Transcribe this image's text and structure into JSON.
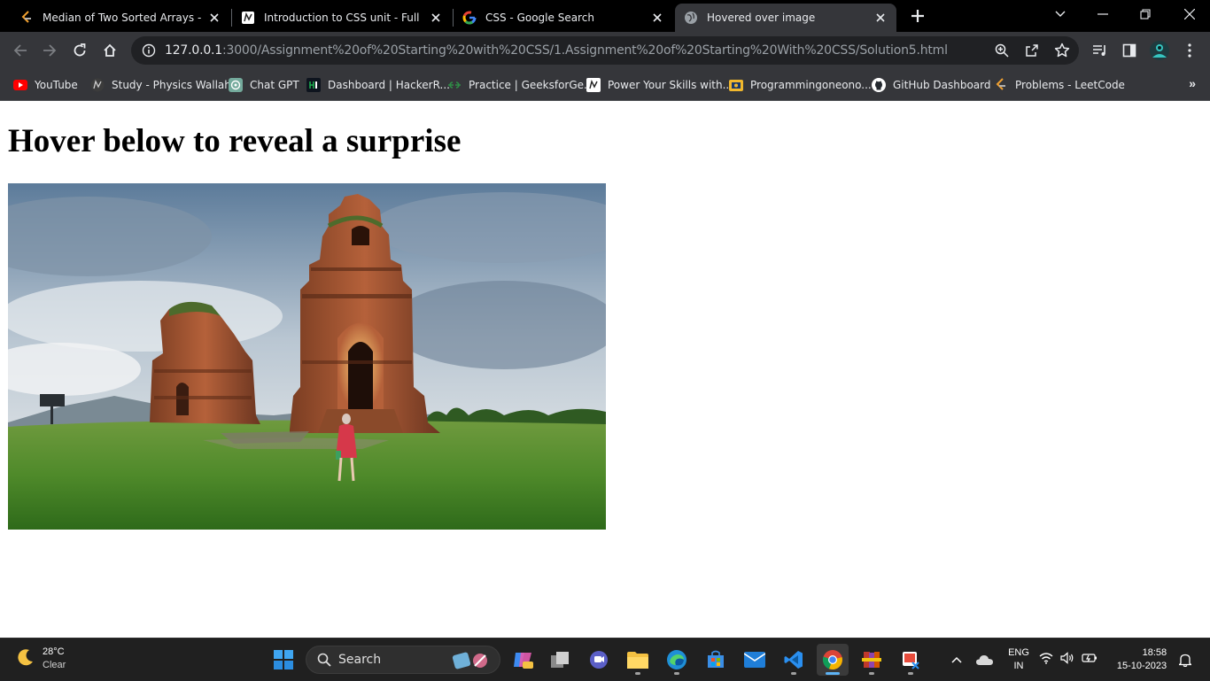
{
  "tabs": [
    {
      "title": "Median of Two Sorted Arrays - LeetCode",
      "icon": "leetcode-icon",
      "active": false
    },
    {
      "title": "Introduction to CSS unit - Full Stack",
      "icon": "pw-icon",
      "active": false
    },
    {
      "title": "CSS - Google Search",
      "icon": "google-icon",
      "active": false
    },
    {
      "title": "Hovered over image",
      "icon": "globe-icon",
      "active": true
    }
  ],
  "address_bar": {
    "host": "127.0.0.1",
    "path": ":3000/Assignment%20of%20Starting%20with%20CSS/1.Assignment%20of%20Starting%20With%20CSS/Solution5.html"
  },
  "bookmarks": [
    {
      "label": "YouTube",
      "icon": "youtube-icon"
    },
    {
      "label": "Study - Physics Wallah",
      "icon": "pw-icon"
    },
    {
      "label": "Chat GPT",
      "icon": "chatgpt-icon"
    },
    {
      "label": "Dashboard | HackerR...",
      "icon": "hackerrank-icon"
    },
    {
      "label": "Practice | GeeksforGe...",
      "icon": "gfg-icon"
    },
    {
      "label": "Power Your Skills with...",
      "icon": "pw-icon"
    },
    {
      "label": "Programmingoneono...",
      "icon": "folder-icon"
    },
    {
      "label": "GitHub Dashboard",
      "icon": "github-icon"
    },
    {
      "label": "Problems - LeetCode",
      "icon": "leetcode-icon"
    }
  ],
  "page": {
    "heading": "Hover below to reveal a surprise"
  },
  "taskbar": {
    "weather_temp": "28°C",
    "weather_cond": "Clear",
    "search_label": "Search",
    "lang_line1": "ENG",
    "lang_line2": "IN",
    "time": "18:58",
    "date": "15-10-2023"
  },
  "colors": {
    "tab_strip": "#000000",
    "toolbar": "#35363a",
    "page_bg": "#ffffff",
    "taskbar": "#202020"
  }
}
